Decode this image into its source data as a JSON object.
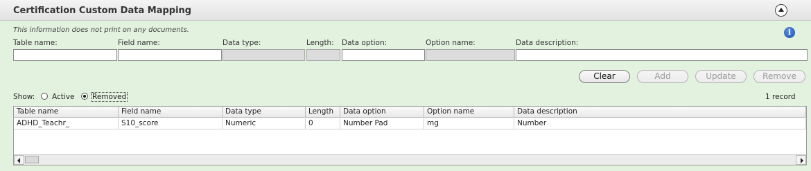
{
  "header": {
    "title": "Certification Custom Data Mapping"
  },
  "note": "This information does not print on any documents.",
  "form": {
    "labels": {
      "table_name": "Table name:",
      "field_name": "Field name:",
      "data_type": "Data type:",
      "length": "Length:",
      "data_option": "Data option:",
      "option_name": "Option name:",
      "data_description": "Data description:"
    },
    "values": {
      "table_name": "",
      "field_name": "",
      "data_type": "",
      "length": "",
      "data_option": "",
      "option_name": "",
      "data_description": ""
    }
  },
  "buttons": {
    "clear": "Clear",
    "add": "Add",
    "update": "Update",
    "remove": "Remove"
  },
  "show": {
    "label": "Show:",
    "options": [
      "Active",
      "Removed"
    ],
    "selected": "Removed"
  },
  "record_count": "1 record",
  "grid": {
    "columns": [
      "Table name",
      "Field name",
      "Data type",
      "Length",
      "Data option",
      "Option name",
      "Data description"
    ],
    "rows": [
      [
        "ADHD_Teachr_",
        "S10_score",
        "Numeric",
        "0",
        "Number Pad",
        "mg",
        "Number"
      ]
    ]
  },
  "icons": {
    "collapse": "chevron-up-circle-icon",
    "info": "info-icon",
    "scroll_left": "arrow-left-icon",
    "scroll_right": "arrow-right-icon"
  },
  "colors": {
    "panel_background": "#e3f1df",
    "info_blue": "#1a4fb0"
  }
}
